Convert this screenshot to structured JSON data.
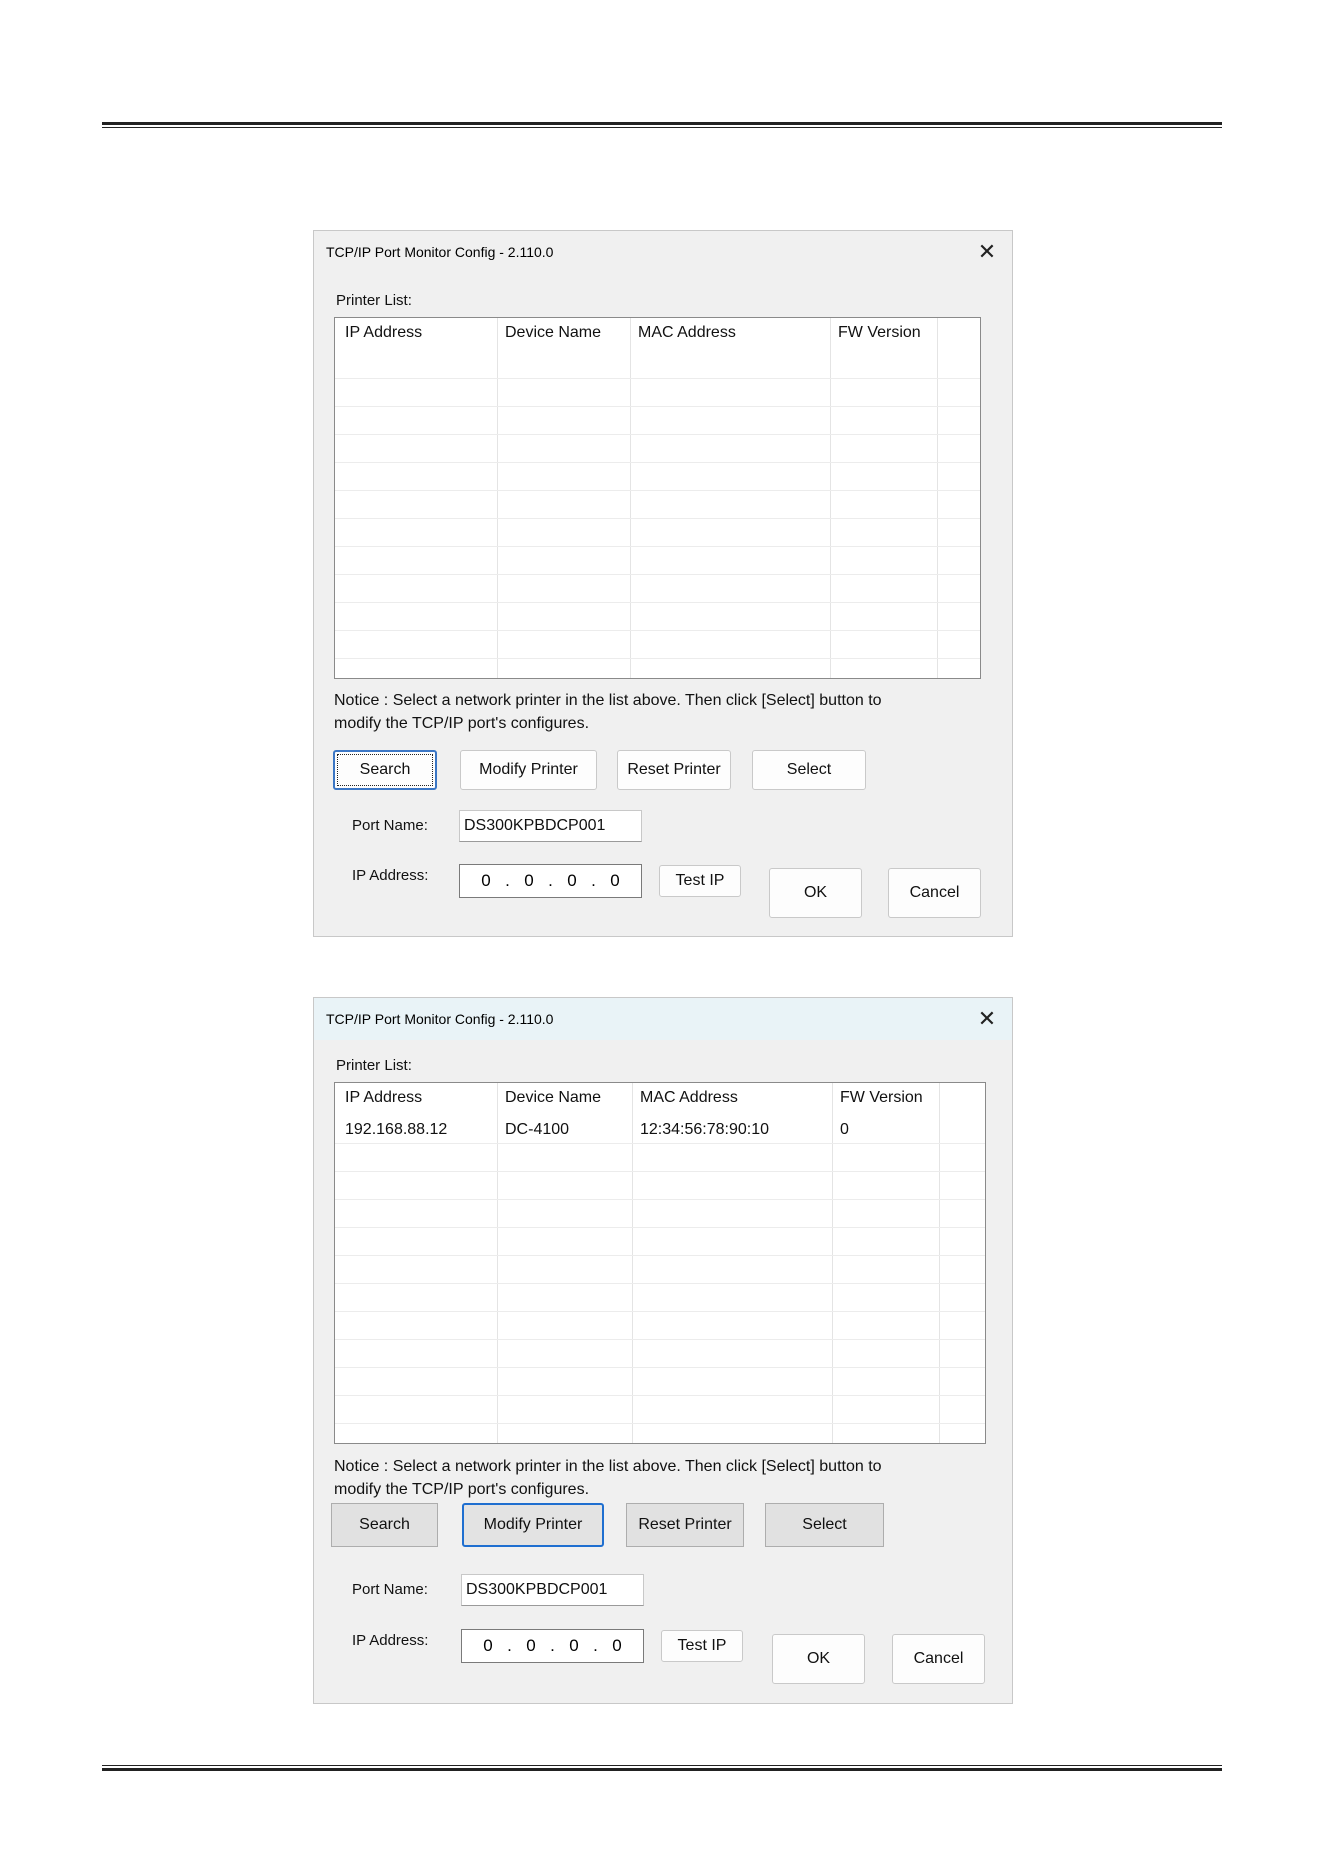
{
  "dialog1": {
    "title": "TCP/IP Port Monitor Config - 2.110.0",
    "printer_list_label": "Printer List:",
    "columns": [
      "IP Address",
      "Device Name",
      "MAC Address",
      "FW Version"
    ],
    "rows": [],
    "notice_line1": "Notice : Select a network printer in the list above. Then click [Select] button to",
    "notice_line2": "modify the TCP/IP port's configures.",
    "buttons": {
      "search": "Search",
      "modify": "Modify Printer",
      "reset": "Reset Printer",
      "select": "Select",
      "test_ip": "Test IP",
      "ok": "OK",
      "cancel": "Cancel"
    },
    "port_name_label": "Port Name:",
    "port_name_value": "DS300KPBDCP001",
    "ip_address_label": "IP Address:",
    "ip_octets": [
      "0",
      "0",
      "0",
      "0"
    ]
  },
  "dialog2": {
    "title": "TCP/IP Port Monitor Config - 2.110.0",
    "printer_list_label": "Printer List:",
    "columns": [
      "IP Address",
      "Device Name",
      "MAC Address",
      "FW Version"
    ],
    "rows": [
      {
        "ip": "192.168.88.12",
        "device": "DC-4100",
        "mac": "12:34:56:78:90:10",
        "fw": "0"
      }
    ],
    "notice_line1": "Notice : Select a network printer in the list above. Then click [Select] button to",
    "notice_line2": "modify the TCP/IP port's configures.",
    "buttons": {
      "search": "Search",
      "modify": "Modify Printer",
      "reset": "Reset Printer",
      "select": "Select",
      "test_ip": "Test IP",
      "ok": "OK",
      "cancel": "Cancel"
    },
    "port_name_label": "Port Name:",
    "port_name_value": "DS300KPBDCP001",
    "ip_address_label": "IP Address:",
    "ip_octets": [
      "0",
      "0",
      "0",
      "0"
    ]
  }
}
